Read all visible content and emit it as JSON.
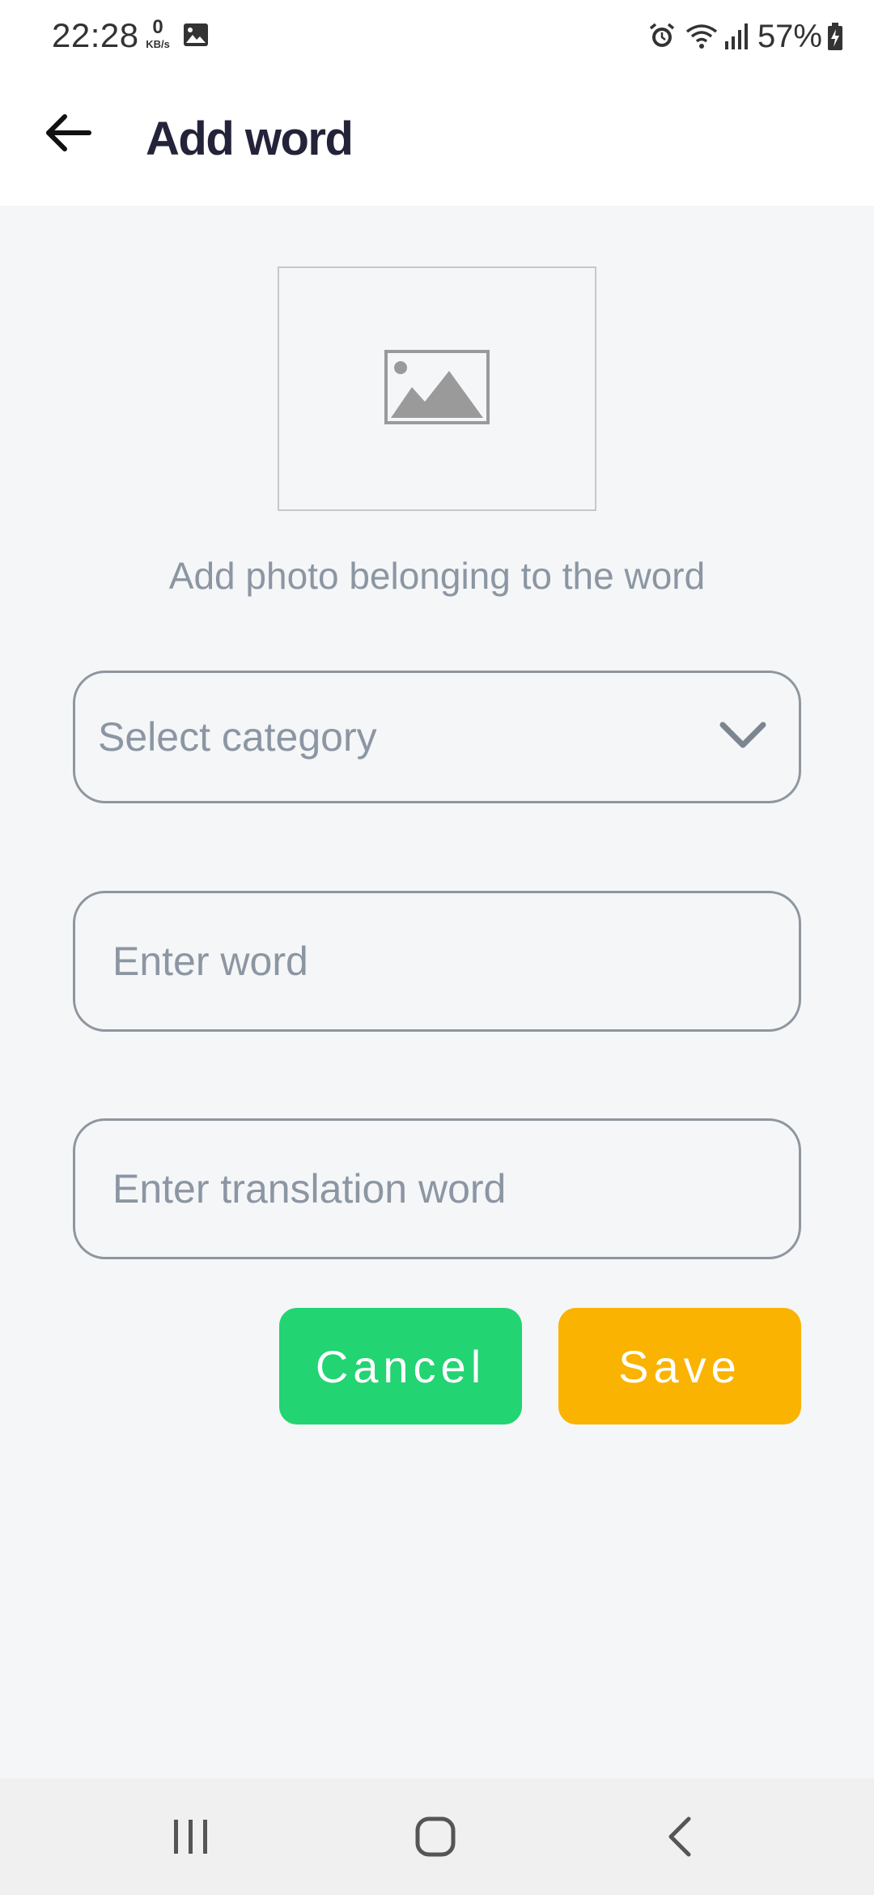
{
  "status_bar": {
    "time": "22:28",
    "net_speed_value": "0",
    "net_speed_unit": "KB/s",
    "battery_percent": "57%",
    "icons": [
      "gallery-icon",
      "alarm-icon",
      "wifi-icon",
      "signal-icon",
      "battery-charging-icon"
    ]
  },
  "header": {
    "back_icon": "arrow-left-icon",
    "title": "Add word"
  },
  "photo": {
    "icon": "image-placeholder-icon",
    "caption": "Add photo belonging to the word"
  },
  "form": {
    "category_placeholder": "Select category",
    "word_placeholder": "Enter word",
    "translation_placeholder": "Enter translation word"
  },
  "buttons": {
    "cancel_label": "Cancel",
    "save_label": "Save",
    "cancel_color": "#22d472",
    "save_color": "#fab300"
  },
  "nav_bar": {
    "icons": [
      "recents-icon",
      "home-icon",
      "back-icon"
    ]
  }
}
